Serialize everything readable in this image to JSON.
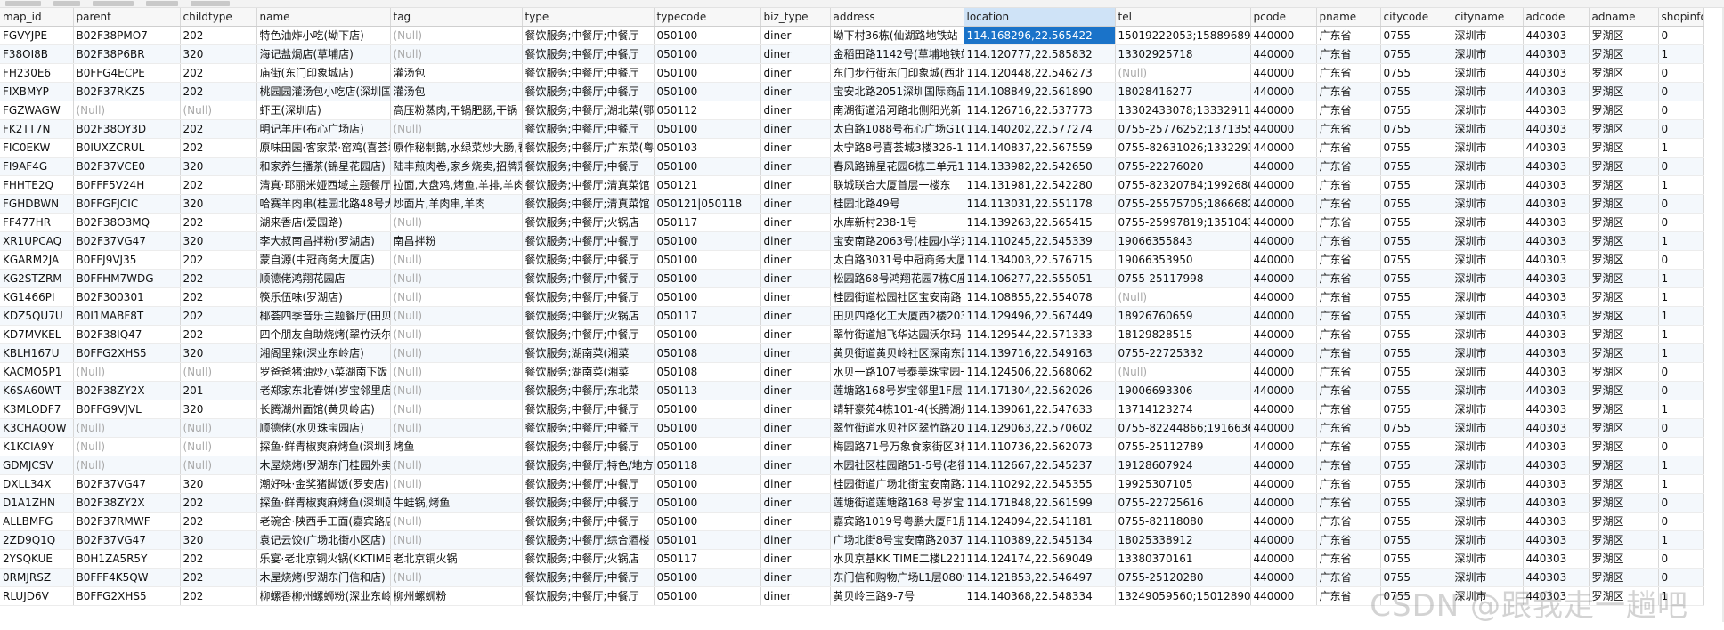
{
  "window": {
    "watermark": "CSDN @跟我走一趟吧"
  },
  "colors": {
    "selection": "#1a73c9",
    "null_text": "#a9a9a9",
    "alt_row": "#f4f8fc"
  },
  "grid": {
    "columns": [
      "map_id",
      "parent",
      "childtype",
      "name",
      "tag",
      "type",
      "typecode",
      "biz_type",
      "address",
      "location",
      "tel",
      "pcode",
      "pname",
      "citycode",
      "cityname",
      "adcode",
      "adname",
      "shopinfo"
    ],
    "selected_column": "location",
    "selected_cell": {
      "row": 0,
      "column": "location"
    },
    "rows": [
      [
        "FGVYJPE",
        "B02F38PMO7",
        "202",
        "特色油炸小吃(坳下店)",
        "(Null)",
        "餐饮服务;中餐厅;中餐厅",
        "050100",
        "diner",
        "坳下村36栋(仙湖路地铁站",
        "114.168296,22.565422",
        "15019222053;1588968984",
        "440000",
        "广东省",
        "0755",
        "深圳市",
        "440303",
        "罗湖区",
        "0"
      ],
      [
        "F38OI8B",
        "B02F38P6BR",
        "320",
        "海记盐焗店(草埔店)",
        "(Null)",
        "餐饮服务;中餐厅;中餐厅",
        "050100",
        "diner",
        "金稻田路1142号(草埔地铁站",
        "114.120777,22.585832",
        "13302925718",
        "440000",
        "广东省",
        "0755",
        "深圳市",
        "440303",
        "罗湖区",
        "1"
      ],
      [
        "FH230E6",
        "B0FFG4ECPE",
        "202",
        "庙街(东门印象城店)",
        "灌汤包",
        "餐饮服务;中餐厅;中餐厅",
        "050100",
        "diner",
        "东门步行街东门印象城(西北",
        "114.120448,22.546273",
        "(Null)",
        "440000",
        "广东省",
        "0755",
        "深圳市",
        "440303",
        "罗湖区",
        "0"
      ],
      [
        "FIXBMYP",
        "B02F37RKZ5",
        "202",
        "桃园园灌汤包小吃店(深圳国",
        "灌汤包",
        "餐饮服务;中餐厅;中餐厅",
        "050100",
        "diner",
        "宝安北路2051深圳国际商品",
        "114.108849,22.561890",
        "18028416277",
        "440000",
        "广东省",
        "0755",
        "深圳市",
        "440303",
        "罗湖区",
        "0"
      ],
      [
        "FGZWAGW",
        "(Null)",
        "(Null)",
        "虾王(深圳店)",
        "高压粉蒸肉,干锅肥肠,干锅",
        "餐饮服务;中餐厅;湖北菜(鄂",
        "050112",
        "diner",
        "南湖街道沿河路北侧阳光新",
        "114.126716,22.537773",
        "13302433078;1333291145",
        "440000",
        "广东省",
        "0755",
        "深圳市",
        "440303",
        "罗湖区",
        "0"
      ],
      [
        "FK2TT7N",
        "B02F38OY3D",
        "202",
        "明记羊庄(布心广场店)",
        "(Null)",
        "餐饮服务;中餐厅;中餐厅",
        "050100",
        "diner",
        "太白路1088号布心广场G10",
        "114.140202,22.577274",
        "0755-25776252;13713553",
        "440000",
        "广东省",
        "0755",
        "深圳市",
        "440303",
        "罗湖区",
        "0"
      ],
      [
        "FIC0EKW",
        "B0IUXZCRUL",
        "202",
        "原味田园·客家菜·窑鸡(喜荟城",
        "原作秘制鹅,水绿菜炒大肠,看",
        "餐饮服务;中餐厅;广东菜(粤菜",
        "050103",
        "diner",
        "太宁路8号喜荟城3楼326-1",
        "114.140837,22.567559",
        "0755-82631026;13322934",
        "440000",
        "广东省",
        "0755",
        "深圳市",
        "440303",
        "罗湖区",
        "1"
      ],
      [
        "FI9AF4G",
        "B02F37VCE0",
        "320",
        "和家养生播茶(锦星花园店)",
        "陆丰煎肉卷,家乡烧卖,招牌藩",
        "餐饮服务;中餐厅;中餐厅",
        "050100",
        "diner",
        "春风路锦星花园6栋二单元1",
        "114.133982,22.542650",
        "0755-22276020",
        "440000",
        "广东省",
        "0755",
        "深圳市",
        "440303",
        "罗湖区",
        "0"
      ],
      [
        "FHHTE2Q",
        "B0FFF5V24H",
        "202",
        "清真·耶丽米娅西域主题餐厅",
        "拉面,大盘鸡,烤鱼,羊排,羊肉串",
        "餐饮服务;中餐厅;清真菜馆",
        "050121",
        "diner",
        "联城联合大厦首层一楼东",
        "114.131981,22.542280",
        "0755-82320784;19926807",
        "440000",
        "广东省",
        "0755",
        "深圳市",
        "440303",
        "罗湖区",
        "1"
      ],
      [
        "FGHDBWN",
        "B0FFGFJCIC",
        "320",
        "哈赛羊肉串(桂园北路48号大",
        "炒面片,羊肉串,羊肉",
        "餐饮服务;中餐厅;清真菜馆",
        "050121|050118",
        "diner",
        "桂园北路49号",
        "114.113031,22.551178",
        "0755-25575705;18666823",
        "440000",
        "广东省",
        "0755",
        "深圳市",
        "440303",
        "罗湖区",
        "0"
      ],
      [
        "FF477HR",
        "B02F38O3MQ",
        "202",
        "湖来香店(爱园路)",
        "(Null)",
        "餐饮服务;中餐厅;火锅店",
        "050117",
        "diner",
        "水库新村238-1号",
        "114.139263,22.565415",
        "0755-25997819;13510435",
        "440000",
        "广东省",
        "0755",
        "深圳市",
        "440303",
        "罗湖区",
        "0"
      ],
      [
        "XR1UPCAQ",
        "B02F37VG47",
        "320",
        "李大叔南昌拌粉(罗湖店)",
        "南昌拌粉",
        "餐饮服务;中餐厅;中餐厅",
        "050100",
        "diner",
        "宝安南路2063号(桂园小学东",
        "114.110245,22.545339",
        "19066355843",
        "440000",
        "广东省",
        "0755",
        "深圳市",
        "440303",
        "罗湖区",
        "1"
      ],
      [
        "KGARM2JA",
        "B0FFJ9VJ35",
        "202",
        "蒙自源(中冠商务大厦店)",
        "(Null)",
        "餐饮服务;中餐厅;中餐厅",
        "050100",
        "diner",
        "太白路3031号中冠商务大厦",
        "114.134003,22.576715",
        "19066353950",
        "440000",
        "广东省",
        "0755",
        "深圳市",
        "440303",
        "罗湖区",
        "0"
      ],
      [
        "KG2STZRM",
        "B0FFHM7WDG",
        "202",
        "顺德佬鸿翔花园店",
        "(Null)",
        "餐饮服务;中餐厅;中餐厅",
        "050100",
        "diner",
        "松园路68号鸿翔花园7栋C座",
        "114.106277,22.555051",
        "0755-25117998",
        "440000",
        "广东省",
        "0755",
        "深圳市",
        "440303",
        "罗湖区",
        "1"
      ],
      [
        "KG1466PI",
        "B02F300301",
        "202",
        "筷乐伍味(罗湖店)",
        "(Null)",
        "餐饮服务;中餐厅;中餐厅",
        "050100",
        "diner",
        "桂园街道松园社区宝安南路",
        "114.108855,22.554078",
        "(Null)",
        "440000",
        "广东省",
        "0755",
        "深圳市",
        "440303",
        "罗湖区",
        "1"
      ],
      [
        "KDZ5QU7U",
        "B0I1MABF8T",
        "202",
        "椰荟四季音乐主题餐厅(田贝",
        "(Null)",
        "餐饮服务;中餐厅;火锅店",
        "050117",
        "diner",
        "田贝四路化工大厦西2楼203",
        "114.129496,22.567449",
        "18926760659",
        "440000",
        "广东省",
        "0755",
        "深圳市",
        "440303",
        "罗湖区",
        "1"
      ],
      [
        "KD7MVKEL",
        "B02F38IQ47",
        "202",
        "四个朋友自助烧烤(翠竹沃尔",
        "(Null)",
        "餐饮服务;中餐厅;中餐厅",
        "050100",
        "diner",
        "翠竹街道旭飞华达园沃尔玛",
        "114.129544,22.571333",
        "18129828515",
        "440000",
        "广东省",
        "0755",
        "深圳市",
        "440303",
        "罗湖区",
        "1"
      ],
      [
        "KBLH167U",
        "B0FFG2XHS5",
        "320",
        "湘阁里辣(深业东岭店)",
        "(Null)",
        "餐饮服务;湖南菜(湘菜",
        "050108",
        "diner",
        "黄贝街道黄贝岭社区深南东路",
        "114.139716,22.549163",
        "0755-22725332",
        "440000",
        "广东省",
        "0755",
        "深圳市",
        "440303",
        "罗湖区",
        "1"
      ],
      [
        "KACMO5P1",
        "(Null)",
        "(Null)",
        "罗爸爸猪油炒小菜湖南下饭",
        "(Null)",
        "餐饮服务;湖南菜(湘菜",
        "050108",
        "diner",
        "水贝一路107号泰美珠宝园一",
        "114.124506,22.568062",
        "(Null)",
        "440000",
        "广东省",
        "0755",
        "深圳市",
        "440303",
        "罗湖区",
        "0"
      ],
      [
        "K6SA60WT",
        "B02F38ZY2X",
        "201",
        "老郑家东北春饼(岁宝邻里店",
        "(Null)",
        "餐饮服务;中餐厅;东北菜",
        "050113",
        "diner",
        "莲塘路168号岁宝邻里1F层",
        "114.171304,22.562026",
        "19006693306",
        "440000",
        "广东省",
        "0755",
        "深圳市",
        "440303",
        "罗湖区",
        "0"
      ],
      [
        "K3MLODF7",
        "B0FFG9VJVL",
        "320",
        "长腾湖州面馆(黄贝岭店)",
        "(Null)",
        "餐饮服务;中餐厅;中餐厅",
        "050100",
        "diner",
        "靖轩豪苑4栋101-4(长腾湖州",
        "114.139061,22.547633",
        "13714123274",
        "440000",
        "广东省",
        "0755",
        "深圳市",
        "440303",
        "罗湖区",
        "1"
      ],
      [
        "K3CHAQOW",
        "(Null)",
        "(Null)",
        "顺德佬(水贝珠宝园店)",
        "(Null)",
        "餐饮服务;中餐厅;中餐厅",
        "050100",
        "diner",
        "翠竹街道水贝社区翠竹路20",
        "114.129063,22.570602",
        "0755-82244866;19166361",
        "440000",
        "广东省",
        "0755",
        "深圳市",
        "440303",
        "罗湖区",
        "0"
      ],
      [
        "K1KCIA9Y",
        "(Null)",
        "(Null)",
        "探鱼·鲜青椒爽麻烤鱼(深圳罗",
        "烤鱼",
        "餐饮服务;中餐厅;中餐厅",
        "050100",
        "diner",
        "梅园路71号万象食家街区3楼",
        "114.110736,22.562073",
        "0755-25112789",
        "440000",
        "广东省",
        "0755",
        "深圳市",
        "440303",
        "罗湖区",
        "0"
      ],
      [
        "GDMJCSV",
        "(Null)",
        "(Null)",
        "木屋烧烤(罗湖东门桂园外卖",
        "(Null)",
        "餐饮服务;中餐厅;特色/地方",
        "050118",
        "diner",
        "木园社区桂园路51-5号(老街",
        "114.112667,22.545237",
        "19128607924",
        "440000",
        "广东省",
        "0755",
        "深圳市",
        "440303",
        "罗湖区",
        "1"
      ],
      [
        "DXLL34X",
        "B02F37VG47",
        "320",
        "潮好味·金奖猪脚饭(罗安店)",
        "(Null)",
        "餐饮服务;中餐厅;中餐厅",
        "050100",
        "diner",
        "桂园街道广场北街宝安南路2",
        "114.110292,22.545355",
        "19925307105",
        "440000",
        "广东省",
        "0755",
        "深圳市",
        "440303",
        "罗湖区",
        "1"
      ],
      [
        "D1A1ZHN",
        "B02F38ZY2X",
        "202",
        "探鱼·鲜青椒爽麻烤鱼(深圳莲",
        "牛蛙锅,烤鱼",
        "餐饮服务;中餐厅;中餐厅",
        "050100",
        "diner",
        "莲塘街道莲塘路168 号岁宝邻",
        "114.171848,22.561599",
        "0755-22725616",
        "440000",
        "广东省",
        "0755",
        "深圳市",
        "440303",
        "罗湖区",
        "0"
      ],
      [
        "ALLBMFG",
        "B02F37RMWF",
        "202",
        "老碗舍·陕西手工面(嘉宾路店",
        "(Null)",
        "餐饮服务;中餐厅;中餐厅",
        "050100",
        "diner",
        "嘉宾路1019号粤鹏大厦F1层",
        "114.124094,22.541181",
        "0755-82118080",
        "440000",
        "广东省",
        "0755",
        "深圳市",
        "440303",
        "罗湖区",
        "0"
      ],
      [
        "2ZD9Q1Q",
        "B02F37VG47",
        "320",
        "袁记云饺(广场北街小区店)",
        "(Null)",
        "餐饮服务;中餐厅;综合酒楼",
        "050101",
        "diner",
        "广场北街8号宝安南路2037号",
        "114.110389,22.545134",
        "18025338912",
        "440000",
        "广东省",
        "0755",
        "深圳市",
        "440303",
        "罗湖区",
        "1"
      ],
      [
        "2YSQKUE",
        "B0H1ZA5R5Y",
        "202",
        "乐宴·老北京铜火锅(KKTIME",
        "老北京铜火锅",
        "餐饮服务;中餐厅;火锅店",
        "050117",
        "diner",
        "水贝京基KK TIME二楼L221",
        "114.124174,22.569049",
        "13380370161",
        "440000",
        "广东省",
        "0755",
        "深圳市",
        "440303",
        "罗湖区",
        "0"
      ],
      [
        "0RMJRSZ",
        "B0FFF4K5QW",
        "202",
        "木屋烧烤(罗湖东门信和店)",
        "(Null)",
        "餐饮服务;中餐厅;中餐厅",
        "050100",
        "diner",
        "东门信和购物广场L1层0809",
        "114.121853,22.546497",
        "0755-25120280",
        "440000",
        "广东省",
        "0755",
        "深圳市",
        "440303",
        "罗湖区",
        "0"
      ],
      [
        "RLUJD6V",
        "B0FFG2XHS5",
        "202",
        "柳螺香柳州螺蛳粉(深业东岭",
        "柳州螺蛳粉",
        "餐饮服务;中餐厅;中餐厅",
        "050100",
        "diner",
        "黄贝岭三路9-7号",
        "114.140368,22.548334",
        "13249059560;1501289027",
        "440000",
        "广东省",
        "0755",
        "深圳市",
        "440303",
        "罗湖区",
        "1"
      ]
    ]
  }
}
